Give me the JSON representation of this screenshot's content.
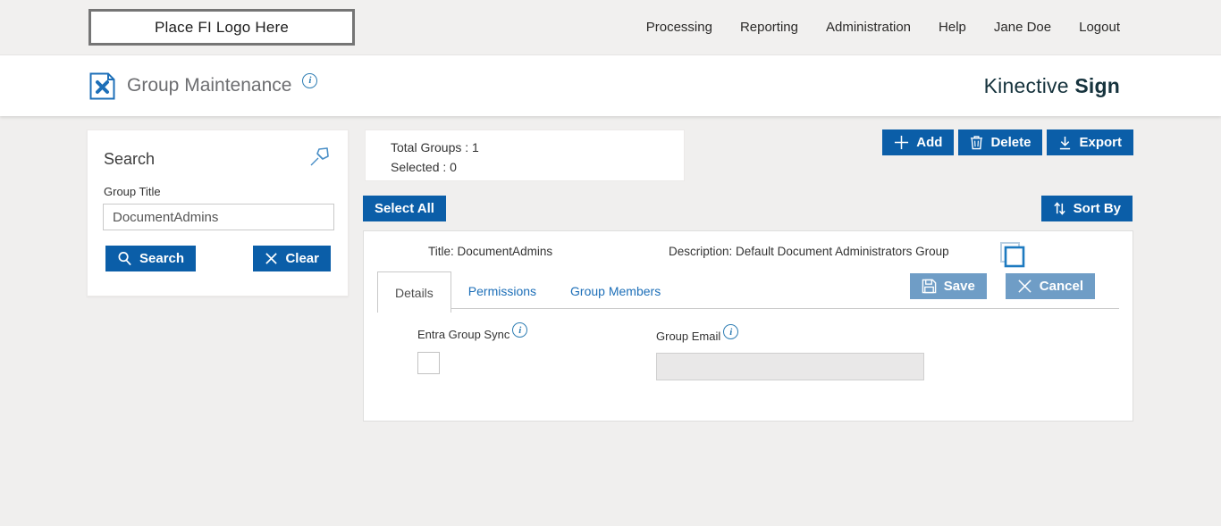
{
  "topbar": {
    "logo_placeholder": "Place FI Logo Here",
    "nav": [
      {
        "label": "Processing"
      },
      {
        "label": "Reporting"
      },
      {
        "label": "Administration"
      },
      {
        "label": "Help"
      },
      {
        "label": "Jane Doe"
      },
      {
        "label": "Logout"
      }
    ]
  },
  "header": {
    "page_title": "Group Maintenance",
    "info_glyph": "i",
    "brand_name": "Kinective",
    "brand_product": "Sign"
  },
  "search_panel": {
    "title": "Search",
    "group_title_label": "Group Title",
    "group_title_value": "DocumentAdmins",
    "search_button": "Search",
    "clear_button": "Clear"
  },
  "summary": {
    "total_groups": "Total Groups : 1",
    "selected": "Selected : 0"
  },
  "toolbar": {
    "add": "Add",
    "delete": "Delete",
    "export": "Export",
    "select_all": "Select All",
    "sort_by": "Sort By"
  },
  "group_card": {
    "title_label": "Title:",
    "title_value": "DocumentAdmins",
    "description_label": "Description:",
    "description_value": "Default Document Administrators Group",
    "tabs": [
      {
        "label": "Details",
        "active": true
      },
      {
        "label": "Permissions",
        "active": false
      },
      {
        "label": "Group Members",
        "active": false
      }
    ],
    "save_button": "Save",
    "cancel_button": "Cancel",
    "details": {
      "entra_label": "Entra Group Sync",
      "entra_checked": false,
      "group_email_label": "Group Email",
      "group_email_value": ""
    }
  },
  "icons": {
    "page-icon": "document-with-tools",
    "info-icon": "circled italic i",
    "pin-icon": "pushpin",
    "search-icon": "magnifier",
    "clear-icon": "x-cross",
    "add-icon": "plus",
    "delete-icon": "trash-can",
    "export-icon": "download-arrow",
    "sort-icon": "up-down-arrows",
    "save-icon": "floppy-disk",
    "cancel-icon": "x-cross",
    "copy-icon": "overlapping-squares"
  },
  "colors": {
    "primary_blue": "#0b5ea8",
    "muted_blue": "#6f9dc6",
    "link_blue": "#1d6fb8",
    "brand_dark": "#16333d",
    "page_bg": "#f0efee",
    "disabled_input_bg": "#e9e8e8"
  }
}
